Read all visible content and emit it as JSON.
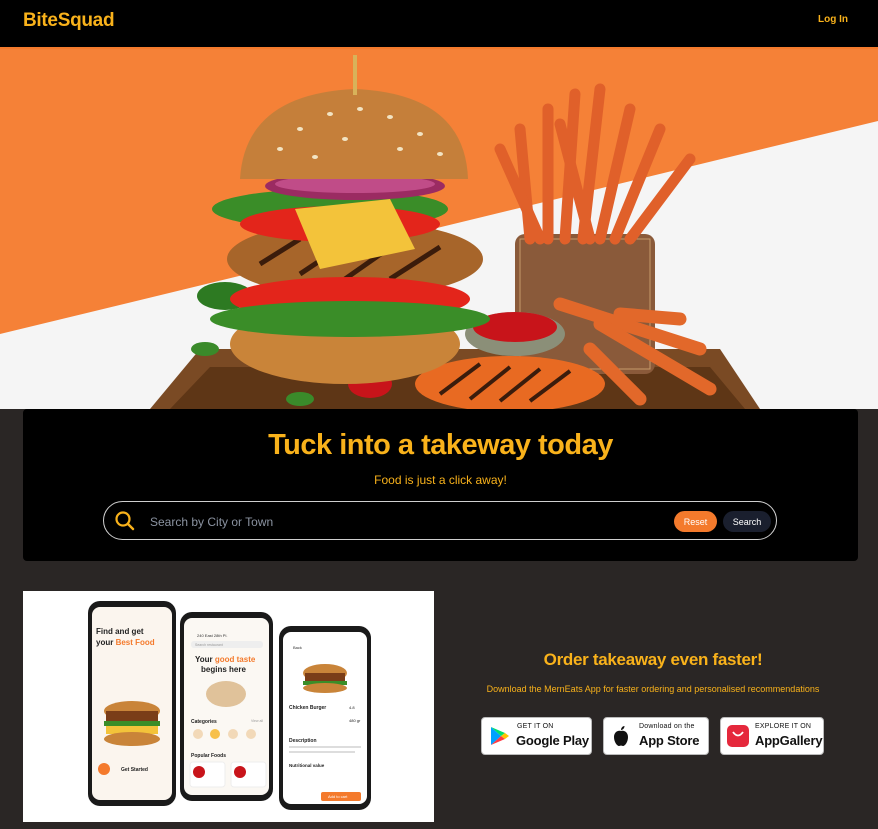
{
  "header": {
    "brand": "BiteSquad",
    "login": "Log In"
  },
  "hero": {
    "image": "burger-and-fries-hero"
  },
  "search": {
    "title": "Tuck into a takeway today",
    "subtitle": "Food is just a click away!",
    "placeholder": "Search by City or Town",
    "reset": "Reset",
    "search": "Search"
  },
  "app": {
    "title": "Order takeaway even faster!",
    "subtitle": "Download the MernEats App for faster ordering and personalised recommendations",
    "phone1": {
      "title_a": "Find and get",
      "title_b": "your",
      "title_c": "Best Food",
      "cta": "Get Started"
    },
    "phone2": {
      "address": "240 East 28th Pl.",
      "search": "Search restaurant",
      "headline_a": "Your",
      "headline_b": "good taste",
      "headline_c": "begins here",
      "categories": "Categories",
      "view_all": "View all",
      "popular": "Popular Foods"
    },
    "phone3": {
      "back": "Back",
      "item": "Chicken Burger",
      "rating": "4.8",
      "weight": "480 gr",
      "description": "Description",
      "nutrition": "Nutritional value",
      "cta": "Add to cart"
    },
    "badges": [
      {
        "small": "GET IT ON",
        "big": "Google Play"
      },
      {
        "small": "Download on the",
        "big": "App Store"
      },
      {
        "small": "EXPLORE IT ON",
        "big": "AppGallery"
      }
    ]
  },
  "colors": {
    "accent": "#f9b21b",
    "orange": "#f47a2c",
    "dark": "#2a2625"
  }
}
